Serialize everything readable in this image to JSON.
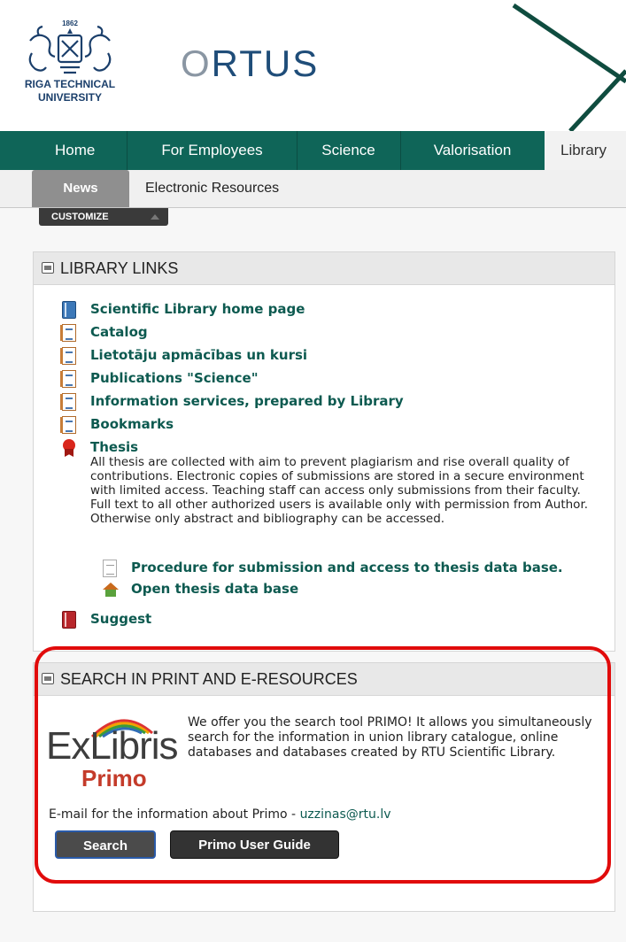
{
  "header": {
    "university": {
      "year": "1862",
      "line1": "RIGA TECHNICAL",
      "line2": "UNIVERSITY"
    },
    "portal_name_prefix": "O",
    "portal_name_rest": "RTUS"
  },
  "nav": {
    "items": [
      {
        "label": "Home"
      },
      {
        "label": "For Employees"
      },
      {
        "label": "Science"
      },
      {
        "label": "Valorisation"
      },
      {
        "label": "Library"
      }
    ],
    "active_color": "#0f6558"
  },
  "subnav": {
    "active": "News",
    "other": "Electronic Resources"
  },
  "customize_label": "CUSTOMIZE",
  "library_links": {
    "title": "LIBRARY LINKS",
    "links": [
      {
        "label": "Scientific Library home page",
        "icon": "book-icon"
      },
      {
        "label": "Catalog",
        "icon": "document-icon"
      },
      {
        "label": "Lietotāju apmācības un kursi",
        "icon": "document-icon"
      },
      {
        "label": "Publications \"Science\"",
        "icon": "document-icon"
      },
      {
        "label": "Information services, prepared by Library",
        "icon": "document-icon"
      },
      {
        "label": "Bookmarks",
        "icon": "document-icon"
      }
    ],
    "thesis": {
      "label": "Thesis",
      "description": "All thesis are collected with aim to prevent plagiarism and rise overall quality of contributions. Electronic copies of submissions are stored in a secure environment with limited access. Teaching staff can access only submissions from their faculty. Full text to all other authorized users is available only with permission from Author. Otherwise only abstract and bibliography can be accessed.",
      "sublinks": [
        {
          "label": "Procedure for submission and access to thesis data base.",
          "icon": "page-icon"
        },
        {
          "label": "Open thesis data base",
          "icon": "house-icon"
        }
      ]
    },
    "suggest": {
      "label": "Suggest",
      "icon": "red-book-icon"
    }
  },
  "search_panel": {
    "title": "SEARCH IN PRINT AND E-RESOURCES",
    "logo_top": "ExLibris",
    "logo_bottom": "Primo",
    "description": "We offer you the search tool PRIMO! It allows you simultaneously search for the information in union library catalogue, online databases and databases created by RTU Scientific Library.",
    "email_prefix": "E-mail for the information about Primo - ",
    "email": "uzzinas@rtu.lv",
    "search_button": "Search",
    "guide_button": "Primo User Guide",
    "highlight_color": "#e10b0b"
  }
}
